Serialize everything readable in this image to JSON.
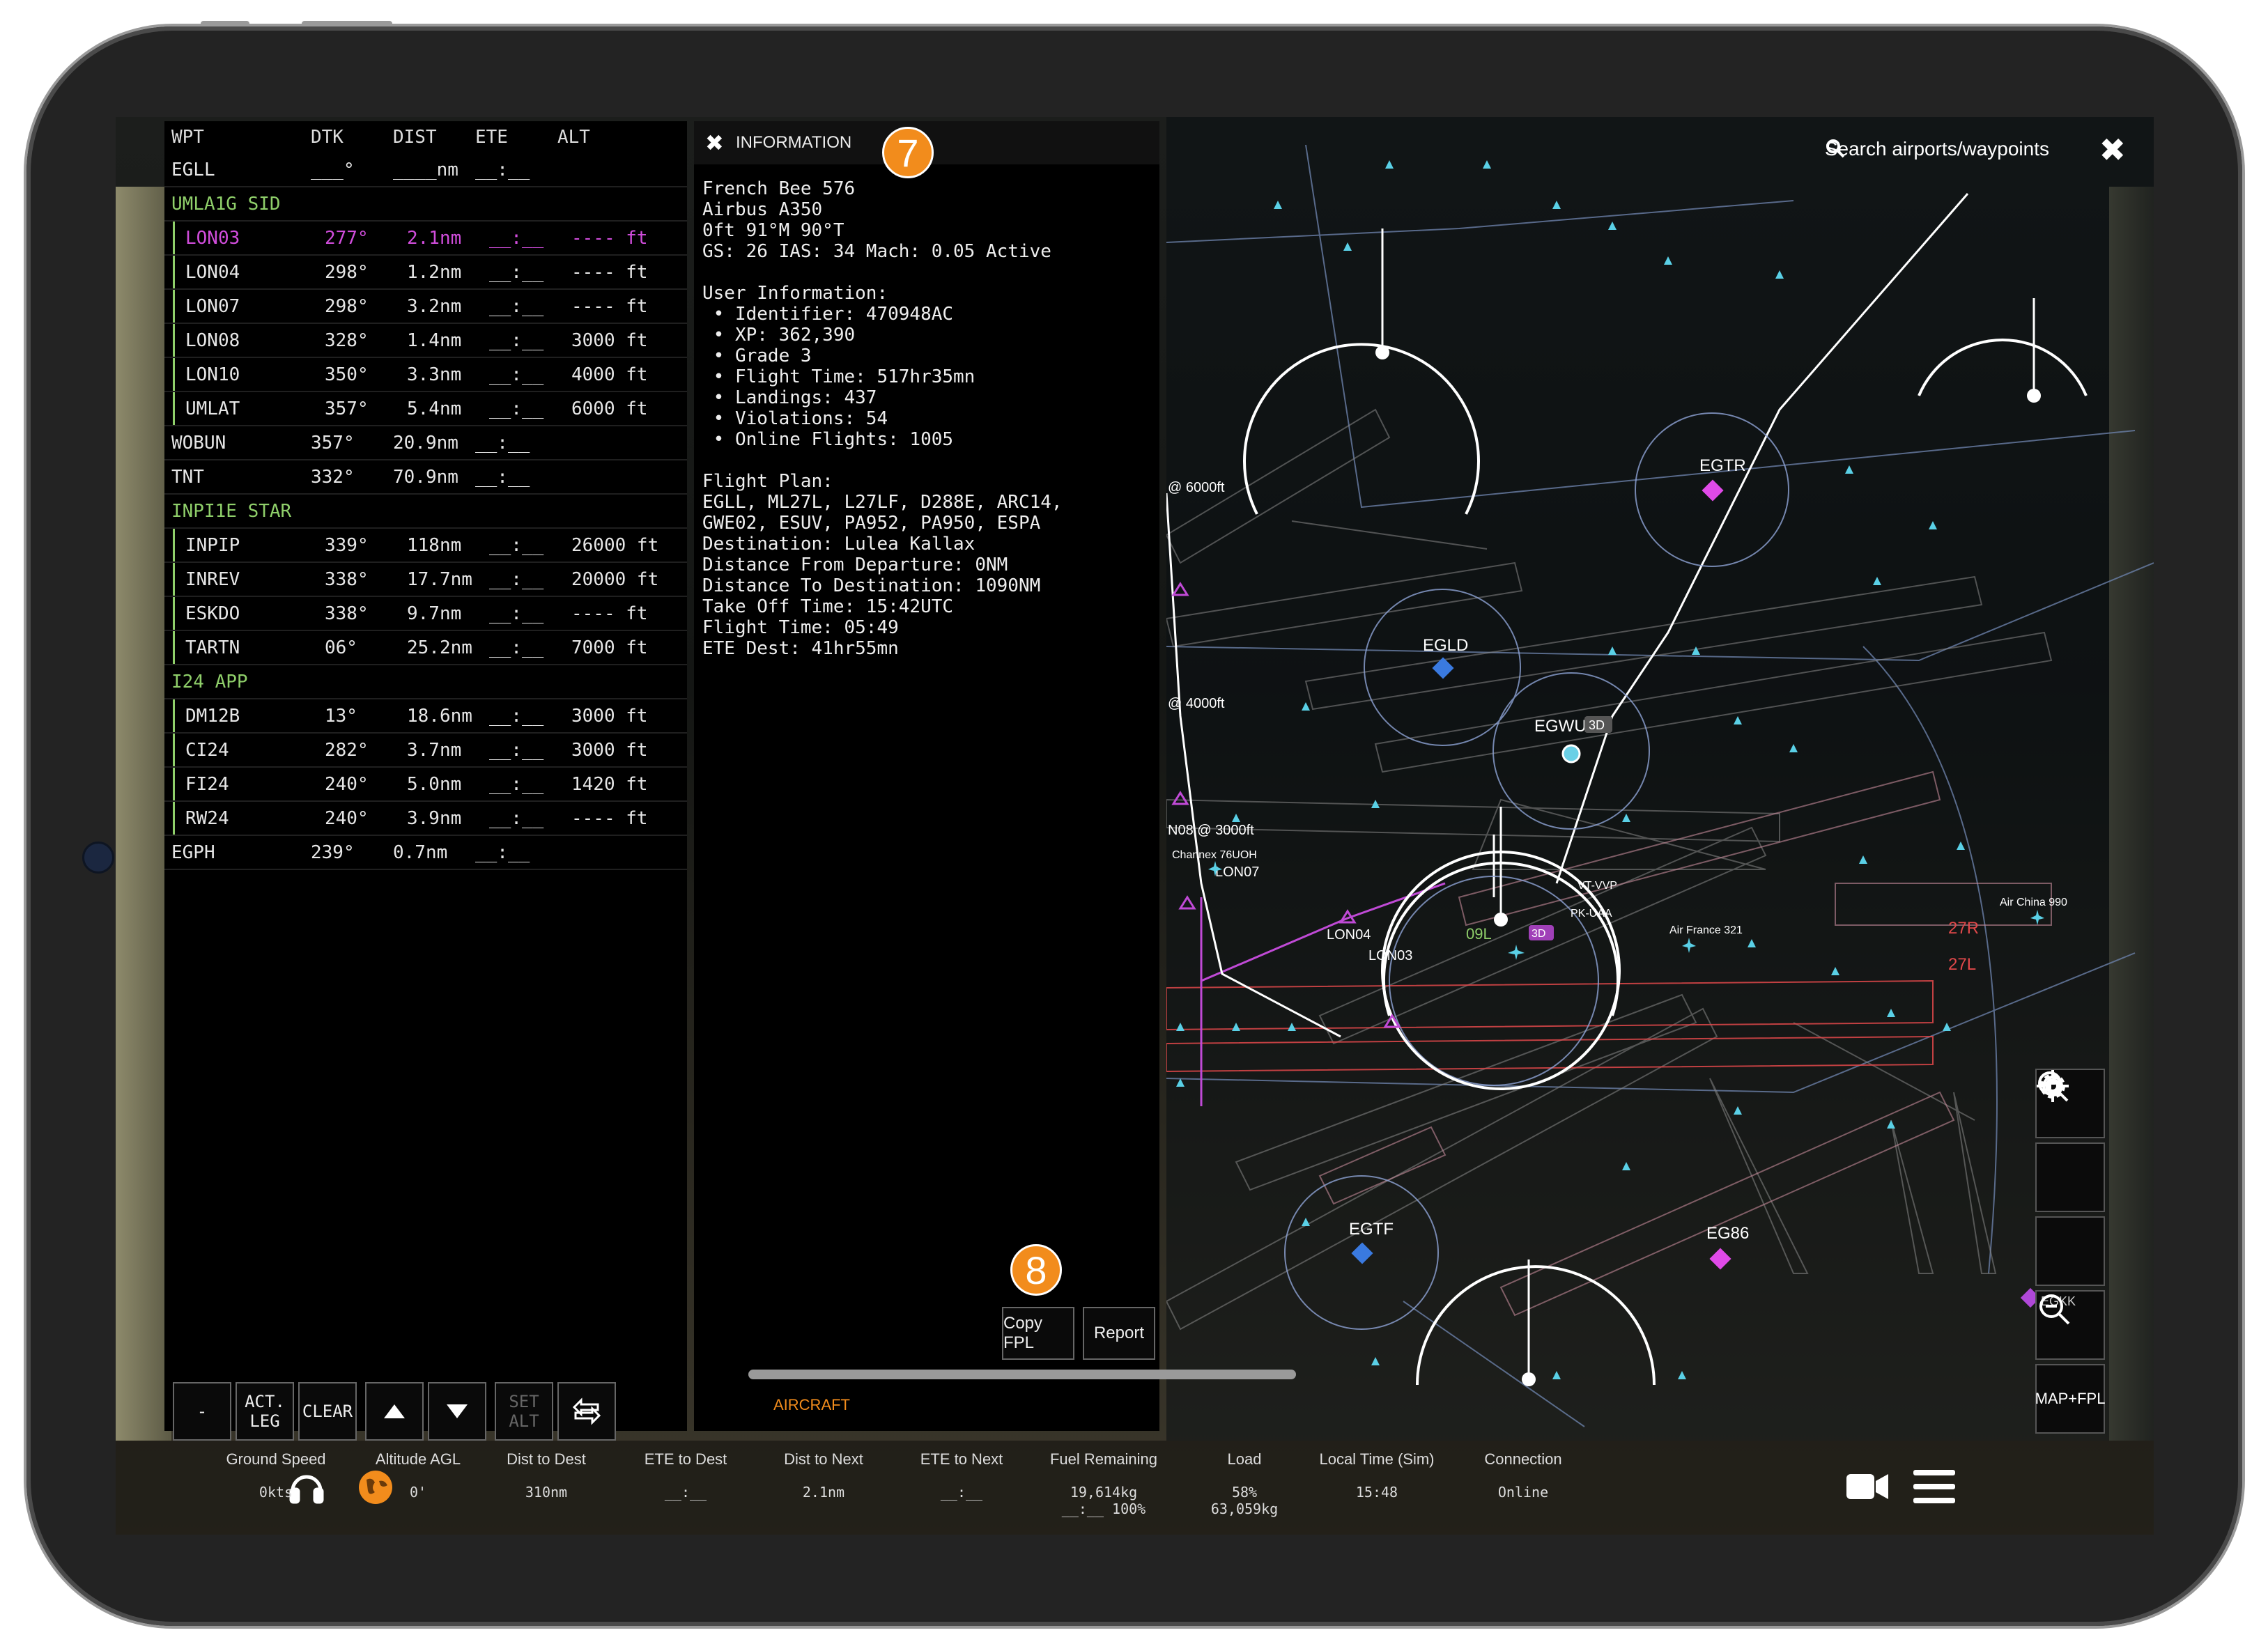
{
  "fpl": {
    "headers": {
      "wpt": "WPT",
      "dtk": "DTK",
      "dist": "DIST",
      "ete": "ETE",
      "alt": "ALT"
    },
    "rows": [
      {
        "wpt": "EGLL",
        "dtk": "___°",
        "dist": "____nm",
        "ete": "__:__",
        "alt": "",
        "kind": "plain"
      },
      {
        "wpt": "UMLA1G SID",
        "kind": "section"
      },
      {
        "wpt": "LON03",
        "dtk": "277°",
        "dist": "2.1nm",
        "ete": "__:__",
        "alt": "---- ft",
        "kind": "active"
      },
      {
        "wpt": "LON04",
        "dtk": "298°",
        "dist": "1.2nm",
        "ete": "__:__",
        "alt": "---- ft",
        "kind": "sub"
      },
      {
        "wpt": "LON07",
        "dtk": "298°",
        "dist": "3.2nm",
        "ete": "__:__",
        "alt": "---- ft",
        "kind": "sub"
      },
      {
        "wpt": "LON08",
        "dtk": "328°",
        "dist": "1.4nm",
        "ete": "__:__",
        "alt": "3000 ft",
        "kind": "sub"
      },
      {
        "wpt": "LON10",
        "dtk": "350°",
        "dist": "3.3nm",
        "ete": "__:__",
        "alt": "4000 ft",
        "kind": "sub"
      },
      {
        "wpt": "UMLAT",
        "dtk": "357°",
        "dist": "5.4nm",
        "ete": "__:__",
        "alt": "6000 ft",
        "kind": "sub"
      },
      {
        "wpt": "WOBUN",
        "dtk": "357°",
        "dist": "20.9nm",
        "ete": "__:__",
        "alt": "",
        "kind": "plain"
      },
      {
        "wpt": "TNT",
        "dtk": "332°",
        "dist": "70.9nm",
        "ete": "__:__",
        "alt": "",
        "kind": "plain"
      },
      {
        "wpt": "INPI1E STAR",
        "kind": "section"
      },
      {
        "wpt": "INPIP",
        "dtk": "339°",
        "dist": "118nm",
        "ete": "__:__",
        "alt": "26000 ft",
        "kind": "sub"
      },
      {
        "wpt": "INREV",
        "dtk": "338°",
        "dist": "17.7nm",
        "ete": "__:__",
        "alt": "20000 ft",
        "kind": "sub"
      },
      {
        "wpt": "ESKDO",
        "dtk": "338°",
        "dist": "9.7nm",
        "ete": "__:__",
        "alt": "---- ft",
        "kind": "sub"
      },
      {
        "wpt": "TARTN",
        "dtk": "06°",
        "dist": "25.2nm",
        "ete": "__:__",
        "alt": "7000 ft",
        "kind": "sub"
      },
      {
        "wpt": "I24 APP",
        "kind": "section"
      },
      {
        "wpt": "DM12B",
        "dtk": "13°",
        "dist": "18.6nm",
        "ete": "__:__",
        "alt": "3000 ft",
        "kind": "sub"
      },
      {
        "wpt": "CI24",
        "dtk": "282°",
        "dist": "3.7nm",
        "ete": "__:__",
        "alt": "3000 ft",
        "kind": "sub"
      },
      {
        "wpt": "FI24",
        "dtk": "240°",
        "dist": "5.0nm",
        "ete": "__:__",
        "alt": "1420 ft",
        "kind": "sub"
      },
      {
        "wpt": "RW24",
        "dtk": "240°",
        "dist": "3.9nm",
        "ete": "__:__",
        "alt": "---- ft",
        "kind": "sub"
      },
      {
        "wpt": "EGPH",
        "dtk": "239°",
        "dist": "0.7nm",
        "ete": "__:__",
        "alt": "",
        "kind": "plain"
      }
    ],
    "buttons": {
      "minus": "-",
      "act_leg": "ACT.\nLEG",
      "clear": "CLEAR",
      "set_alt": "SET\nALT"
    }
  },
  "info": {
    "title": "INFORMATION",
    "badge_7": "7",
    "badge_8": "8",
    "lines": [
      "French Bee 576",
      "Airbus A350",
      "0ft 91°M 90°T",
      "GS: 26 IAS: 34 Mach: 0.05 Active",
      "",
      "User Information:",
      " • Identifier: 470948AC",
      " • XP: 362,390",
      " • Grade 3",
      " • Flight Time: 517hr35mn",
      " • Landings: 437",
      " • Violations: 54",
      " • Online Flights: 1005",
      "",
      "Flight Plan:",
      "EGLL, ML27L, L27LF, D288E, ARC14,",
      "GWE02, ESUV, PA952, PA950, ESPA",
      "Destination: Lulea Kallax",
      "Distance From Departure: 0NM",
      "Distance To Destination: 1090NM",
      "Take Off Time: 15:42UTC",
      "Flight Time: 05:49",
      "ETE Dest: 41hr55mn"
    ],
    "copy_fpl": "Copy FPL",
    "report": "Report",
    "tab": "AIRCRAFT"
  },
  "map": {
    "search_placeholder": "Search airports/waypoints",
    "airports": {
      "egtr": "EGTR",
      "egld": "EGLD",
      "egwu": "EGWU",
      "egwu_badge": "3D",
      "egtf": "EGTF",
      "eg86": "EG86",
      "egll_badge": "3D"
    },
    "labels": {
      "alt_6000": "@ 6000ft",
      "alt_4000": "@ 4000ft",
      "lon08_alt": "N08 @ 3000ft",
      "lon07": "LON07",
      "lon04": "LON04",
      "lon03": "LON03",
      "rw_27r": "27R",
      "rw_27l": "27L",
      "rw_09l": "09L",
      "channex": "Channex 76UOH",
      "air_france": "Air France 321",
      "air_china": "Air China 990",
      "pk": "PK-UAA",
      "vt": "VT-VVP",
      "egkk": "EGKK"
    },
    "map_fpl": "MAP+FPL"
  },
  "bottom": {
    "stats": [
      {
        "label": "Ground Speed",
        "value": "0kts"
      },
      {
        "label": "Altitude AGL",
        "value": "0'"
      },
      {
        "label": "Dist to Dest",
        "value": "310nm"
      },
      {
        "label": "ETE to Dest",
        "value": "__:__"
      },
      {
        "label": "Dist to Next",
        "value": "2.1nm"
      },
      {
        "label": "ETE to Next",
        "value": "__:__"
      },
      {
        "label": "Fuel Remaining",
        "value": "19,614kg\n__:__ 100%"
      },
      {
        "label": "Load",
        "value": "58%\n63,059kg"
      },
      {
        "label": "Local Time (Sim)",
        "value": "15:48"
      },
      {
        "label": "Connection",
        "value": "Online"
      }
    ]
  },
  "colors": {
    "accent": "#f28c1c",
    "section": "#8fcf6a",
    "active": "#d14ddc",
    "waypoint": "#5ad0e6"
  }
}
